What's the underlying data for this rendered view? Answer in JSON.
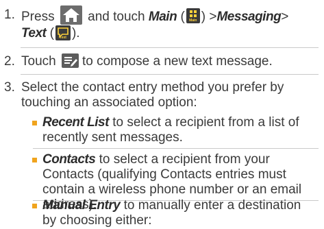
{
  "steps": [
    {
      "num": "1.",
      "press": "Press",
      "and_touch": "and touch",
      "main": "Main",
      "open_paren": "(",
      "main_icon_label": "Main",
      "close_sep": ") >",
      "messaging": "Messaging",
      "gt": ">",
      "text": "Text",
      "text_open": "(",
      "text_icon_label": "Text",
      "text_close": ")."
    },
    {
      "num": "2.",
      "touch": "Touch",
      "rest": "to compose a new text message."
    },
    {
      "num": "3.",
      "line1": "Select the contact entry method you prefer by",
      "line2": "touching an associated option:"
    }
  ],
  "options": [
    {
      "term": "Recent List",
      "desc": " to select a recipient from a list of recently sent messages."
    },
    {
      "term": "Contacts",
      "desc": " to select a recipient from your Contacts (qualifying Contacts entries must contain a wireless phone number or an email address)."
    },
    {
      "term": "Manual Entry",
      "desc": " to manually enter a destination by choosing either:"
    }
  ],
  "colors": {
    "bullet": "#f0a41e",
    "text": "#3a3a3a",
    "home_icon_bg": "#6c6c6c",
    "icon_dark": "#3a3a3a",
    "icon_accent": "#ffd23a",
    "rule": "#c9c9c9"
  },
  "icons": [
    "home-key-icon",
    "main-menu-icon",
    "text-message-icon",
    "compose-icon"
  ]
}
